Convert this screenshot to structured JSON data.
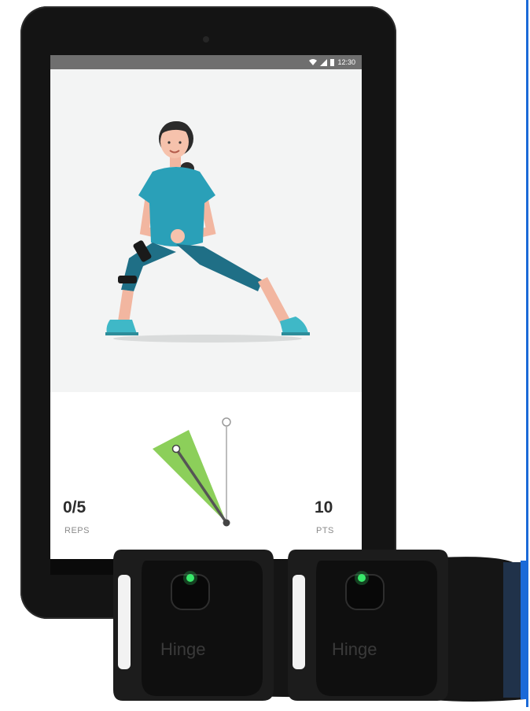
{
  "status_bar": {
    "time": "12:30"
  },
  "stats": {
    "reps_value": "0/5",
    "reps_label": "REPS",
    "points_value": "10",
    "points_label": "PTS"
  },
  "sensor": {
    "brand": "Hinge"
  },
  "colors": {
    "tablet_frame": "#141414",
    "screen_bg": "#f3f4f4",
    "accent_green": "#8ccf5a",
    "shirt_teal": "#2aa0b8",
    "leggings_teal": "#1f6f86",
    "shoe_teal": "#3fb8c7",
    "led_green": "#39e86a"
  }
}
